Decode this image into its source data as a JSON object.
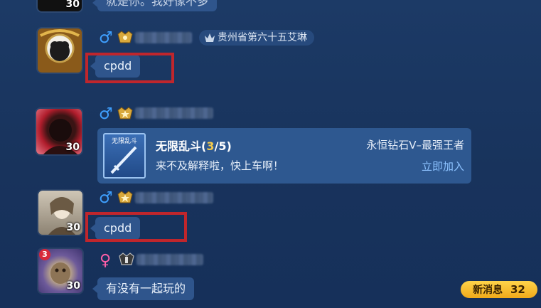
{
  "messages": [
    {
      "id": "m0",
      "level": "30",
      "text": "就是你。我好像不多",
      "partial": true
    },
    {
      "id": "m1",
      "gender": "♂",
      "title_tag": "贵州省第六十五艾琳",
      "level": "",
      "text": "cpdd",
      "highlighted": true
    },
    {
      "id": "m2",
      "gender": "♂",
      "level": "30",
      "card": {
        "thumb_label": "无限乱斗",
        "mode": "无限乱斗",
        "count_current": "3",
        "count_total": "/5",
        "rank": "永恒钻石V–最强王者",
        "message": "来不及解释啦，快上车啊！",
        "join_label": "立即加入"
      }
    },
    {
      "id": "m3",
      "gender": "♂",
      "level": "30",
      "text": "cpdd",
      "highlighted": true
    },
    {
      "id": "m4",
      "gender": "♀",
      "badge": "3",
      "level": "30",
      "text": "有没有一起玩的"
    }
  ],
  "new_message": {
    "label": "新消息",
    "count": "32"
  },
  "colors": {
    "background": "#1c3a66",
    "bubble": "#2f558c",
    "highlight_box": "#c0262c",
    "male": "#3fa0ff",
    "female": "#ff5fa8",
    "accent_gold": "#f2c94c",
    "join_link": "#8cc2ff"
  }
}
